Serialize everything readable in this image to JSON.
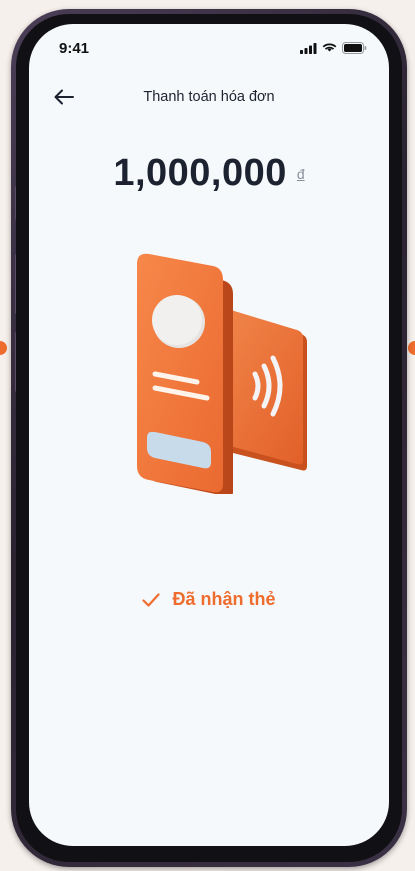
{
  "status_bar": {
    "time": "9:41",
    "icons": [
      "signal-icon",
      "wifi-icon",
      "battery-icon"
    ]
  },
  "header": {
    "title": "Thanh toán hóa đơn",
    "back_icon": "arrow-left-icon"
  },
  "payment": {
    "amount": "1,000,000",
    "currency": "đ"
  },
  "card_status": {
    "label": "Đã nhận thẻ",
    "icon": "checkmark-icon"
  },
  "colors": {
    "accent": "#ee6d2e",
    "screen_bg": "#f6f9fb",
    "text_primary": "#1d2230"
  }
}
